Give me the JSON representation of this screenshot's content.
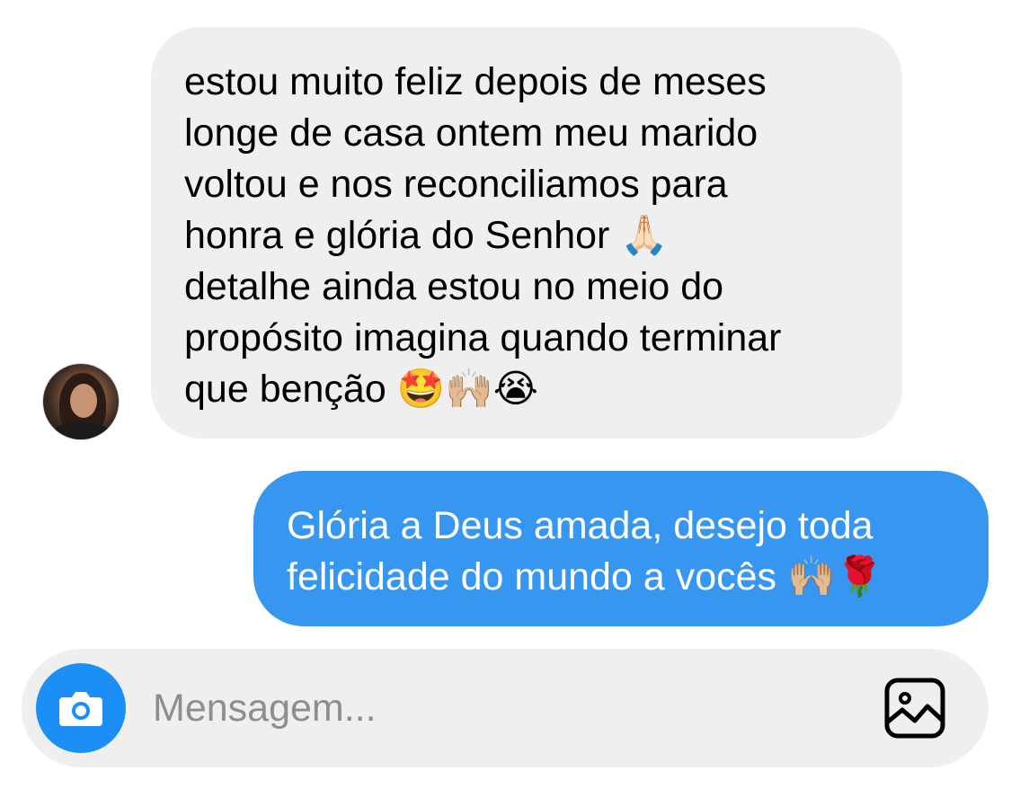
{
  "conversation": {
    "messages": [
      {
        "direction": "received",
        "text": "estou muito feliz depois de meses\nlonge de casa ontem meu marido\nvoltou e nos reconciliamos para\nhonra e glória do Senhor 🙏🏻\ndetalhe ainda estou no meio do\npropósito imagina quando terminar\nque benção 🤩🙌🏼😭"
      },
      {
        "direction": "sent",
        "text": "Glória a Deus amada, desejo toda\nfelicidade do mundo a vocês 🙌🏼🌹"
      }
    ]
  },
  "composer": {
    "placeholder": "Mensagem...",
    "value": ""
  },
  "colors": {
    "received_bubble": "#efefef",
    "sent_bubble": "#3797f0",
    "camera_button": "#1b8ff5",
    "composer_bg": "#efefef",
    "placeholder": "#8e8e8e"
  },
  "icons": {
    "camera": "camera-icon",
    "gallery": "image-gallery-icon",
    "avatar": "avatar"
  }
}
